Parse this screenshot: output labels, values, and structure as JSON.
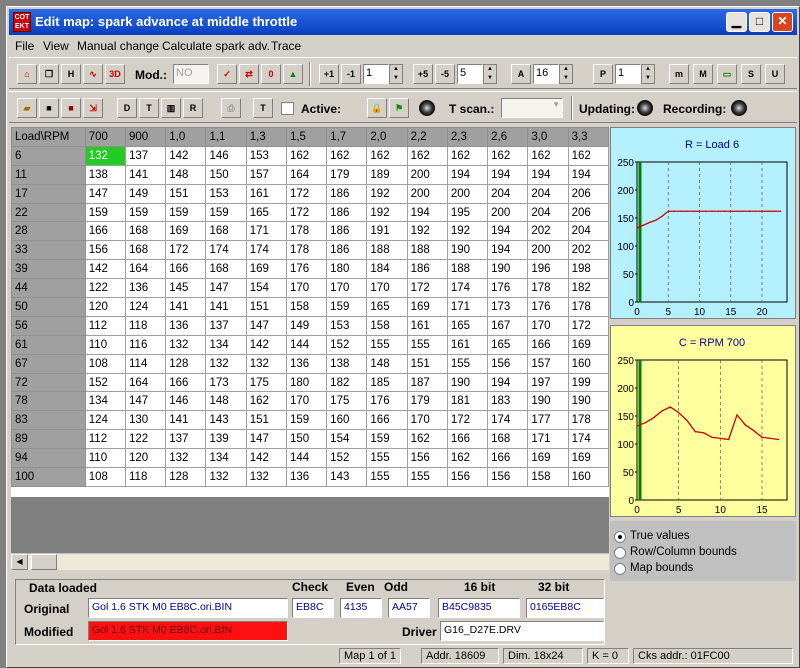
{
  "window": {
    "title": "Edit map: spark advance at middle throttle",
    "icon_text": "COT EKT"
  },
  "menu": [
    "File",
    "View",
    "Manual change",
    "Calculate spark adv.",
    "Trace"
  ],
  "toolbar1": {
    "mod_label": "Mod.:",
    "mod_value": "NO",
    "spin1": "1",
    "spin2": "5",
    "spin3": "16",
    "spin4": "1",
    "icons": [
      "A",
      "P",
      "m",
      "M",
      "S",
      "U"
    ]
  },
  "toolbar2": {
    "active_label": "Active:",
    "tscan_label": "T scan.:",
    "updating_label": "Updating:",
    "recording_label": "Recording:"
  },
  "table": {
    "corner": "Load\\RPM",
    "cols": [
      "700",
      "900",
      "1,0",
      "1,1",
      "1,3",
      "1,5",
      "1,7",
      "2,0",
      "2,2",
      "2,3",
      "2,6",
      "3,0",
      "3,3"
    ],
    "rows": [
      {
        "load": "6",
        "v": [
          "132",
          "137",
          "142",
          "146",
          "153",
          "162",
          "162",
          "162",
          "162",
          "162",
          "162",
          "162",
          "162"
        ]
      },
      {
        "load": "11",
        "v": [
          "138",
          "141",
          "148",
          "150",
          "157",
          "164",
          "179",
          "189",
          "200",
          "194",
          "194",
          "194",
          "194"
        ]
      },
      {
        "load": "17",
        "v": [
          "147",
          "149",
          "151",
          "153",
          "161",
          "172",
          "186",
          "192",
          "200",
          "200",
          "204",
          "204",
          "206"
        ]
      },
      {
        "load": "22",
        "v": [
          "159",
          "159",
          "159",
          "159",
          "165",
          "172",
          "186",
          "192",
          "194",
          "195",
          "200",
          "204",
          "206"
        ]
      },
      {
        "load": "28",
        "v": [
          "166",
          "168",
          "169",
          "168",
          "171",
          "178",
          "186",
          "191",
          "192",
          "192",
          "194",
          "202",
          "204"
        ]
      },
      {
        "load": "33",
        "v": [
          "156",
          "168",
          "172",
          "174",
          "174",
          "178",
          "186",
          "188",
          "188",
          "190",
          "194",
          "200",
          "202"
        ]
      },
      {
        "load": "39",
        "v": [
          "142",
          "164",
          "166",
          "168",
          "169",
          "176",
          "180",
          "184",
          "186",
          "188",
          "190",
          "196",
          "198"
        ]
      },
      {
        "load": "44",
        "v": [
          "122",
          "136",
          "145",
          "147",
          "154",
          "170",
          "170",
          "170",
          "172",
          "174",
          "176",
          "178",
          "182"
        ]
      },
      {
        "load": "50",
        "v": [
          "120",
          "124",
          "141",
          "141",
          "151",
          "158",
          "159",
          "165",
          "169",
          "171",
          "173",
          "176",
          "178"
        ]
      },
      {
        "load": "56",
        "v": [
          "112",
          "118",
          "136",
          "137",
          "147",
          "149",
          "153",
          "158",
          "161",
          "165",
          "167",
          "170",
          "172"
        ]
      },
      {
        "load": "61",
        "v": [
          "110",
          "116",
          "132",
          "134",
          "142",
          "144",
          "152",
          "155",
          "155",
          "161",
          "165",
          "166",
          "169"
        ]
      },
      {
        "load": "67",
        "v": [
          "108",
          "114",
          "128",
          "132",
          "132",
          "136",
          "138",
          "148",
          "151",
          "155",
          "156",
          "157",
          "160"
        ]
      },
      {
        "load": "72",
        "v": [
          "152",
          "164",
          "166",
          "173",
          "175",
          "180",
          "182",
          "185",
          "187",
          "190",
          "194",
          "197",
          "199"
        ]
      },
      {
        "load": "78",
        "v": [
          "134",
          "147",
          "146",
          "148",
          "162",
          "170",
          "175",
          "176",
          "179",
          "181",
          "183",
          "190",
          "190"
        ]
      },
      {
        "load": "83",
        "v": [
          "124",
          "130",
          "141",
          "143",
          "151",
          "159",
          "160",
          "166",
          "170",
          "172",
          "174",
          "177",
          "178"
        ]
      },
      {
        "load": "89",
        "v": [
          "112",
          "122",
          "137",
          "139",
          "147",
          "150",
          "154",
          "159",
          "162",
          "166",
          "168",
          "171",
          "174"
        ]
      },
      {
        "load": "94",
        "v": [
          "110",
          "120",
          "132",
          "134",
          "142",
          "144",
          "152",
          "155",
          "156",
          "162",
          "166",
          "169",
          "169"
        ]
      },
      {
        "load": "100",
        "v": [
          "108",
          "118",
          "128",
          "132",
          "132",
          "136",
          "143",
          "155",
          "155",
          "156",
          "156",
          "158",
          "160"
        ]
      }
    ]
  },
  "chart_data": [
    {
      "type": "line",
      "title": "R = Load 6",
      "x": [
        0,
        1,
        2,
        3,
        4,
        5,
        6,
        7,
        8,
        9,
        10,
        11,
        12,
        13,
        14,
        15,
        16,
        17,
        18,
        19,
        20,
        21,
        22,
        23
      ],
      "values": [
        132,
        137,
        142,
        146,
        153,
        162,
        162,
        162,
        162,
        162,
        162,
        162,
        162,
        162,
        162,
        162,
        162,
        162,
        162,
        162,
        162,
        162,
        162,
        162
      ],
      "xlim": [
        0,
        24
      ],
      "ylim": [
        0,
        250
      ],
      "xticks": [
        0,
        5,
        10,
        15,
        20
      ],
      "yticks": [
        0,
        50,
        100,
        150,
        200,
        250
      ]
    },
    {
      "type": "line",
      "title": "C = RPM 700",
      "x": [
        0,
        1,
        2,
        3,
        4,
        5,
        6,
        7,
        8,
        9,
        10,
        11,
        12,
        13,
        14,
        15,
        16,
        17
      ],
      "values": [
        132,
        138,
        147,
        159,
        166,
        156,
        142,
        122,
        120,
        112,
        110,
        108,
        152,
        134,
        124,
        112,
        110,
        108
      ],
      "xlim": [
        0,
        18
      ],
      "ylim": [
        0,
        250
      ],
      "xticks": [
        0,
        5,
        10,
        15
      ],
      "yticks": [
        0,
        50,
        100,
        150,
        200,
        250
      ]
    }
  ],
  "radios": [
    {
      "label": "True values",
      "checked": true
    },
    {
      "label": "Row/Column bounds",
      "checked": false
    },
    {
      "label": "Map bounds",
      "checked": false
    }
  ],
  "data_loaded": {
    "title": "Data loaded",
    "headers": {
      "check": "Check",
      "even": "Even",
      "odd": "Odd",
      "b16": "16 bit",
      "b32": "32 bit"
    },
    "original_label": "Original",
    "original_file": "Gol 1.6 STK M0 EB8C.ori.BIN",
    "check": "EB8C",
    "even": "4135",
    "odd": "AA57",
    "b16": "B45C9835",
    "b32": "0165EB8C",
    "modified_label": "Modified",
    "modified_file": "Gol 1.6 STK M0 EB8C.ori.BIN",
    "driver_label": "Driver",
    "driver": "G16_D27E.DRV"
  },
  "status": {
    "map": "Map 1 of 1",
    "addr": "Addr. 18609",
    "dim": "Dim. 18x24",
    "k": "K = 0",
    "cks": "Cks addr.: 01FC00"
  },
  "colors": {
    "title_bar": "#0a3fbf",
    "selected_cell": "#22cc22",
    "chart1_bg": "#b4f0ff",
    "chart2_bg": "#ffffa0",
    "line": "#cc0000",
    "modified_bg": "#ff1010"
  }
}
